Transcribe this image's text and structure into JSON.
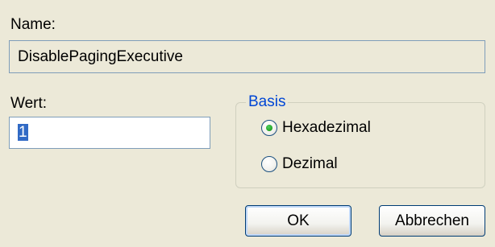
{
  "dialog": {
    "name_label": "Name:",
    "name_value": "DisablePagingExecutive",
    "value_label": "Wert:",
    "value_value": "1",
    "basis": {
      "legend": "Basis",
      "options": [
        {
          "label": "Hexadezimal",
          "selected": true
        },
        {
          "label": "Dezimal",
          "selected": false
        }
      ]
    },
    "buttons": {
      "ok_label": "OK",
      "cancel_label": "Abbrechen"
    }
  },
  "colors": {
    "background": "#ece9d8",
    "field_border": "#7f9db9",
    "legend_text": "#0046d5",
    "selection": "#316ac5",
    "radio_dot": "#21a121",
    "button_border": "#003c74"
  },
  "icons": {
    "radio_checked": "radio-checked-icon",
    "radio_unchecked": "radio-unchecked-icon"
  }
}
